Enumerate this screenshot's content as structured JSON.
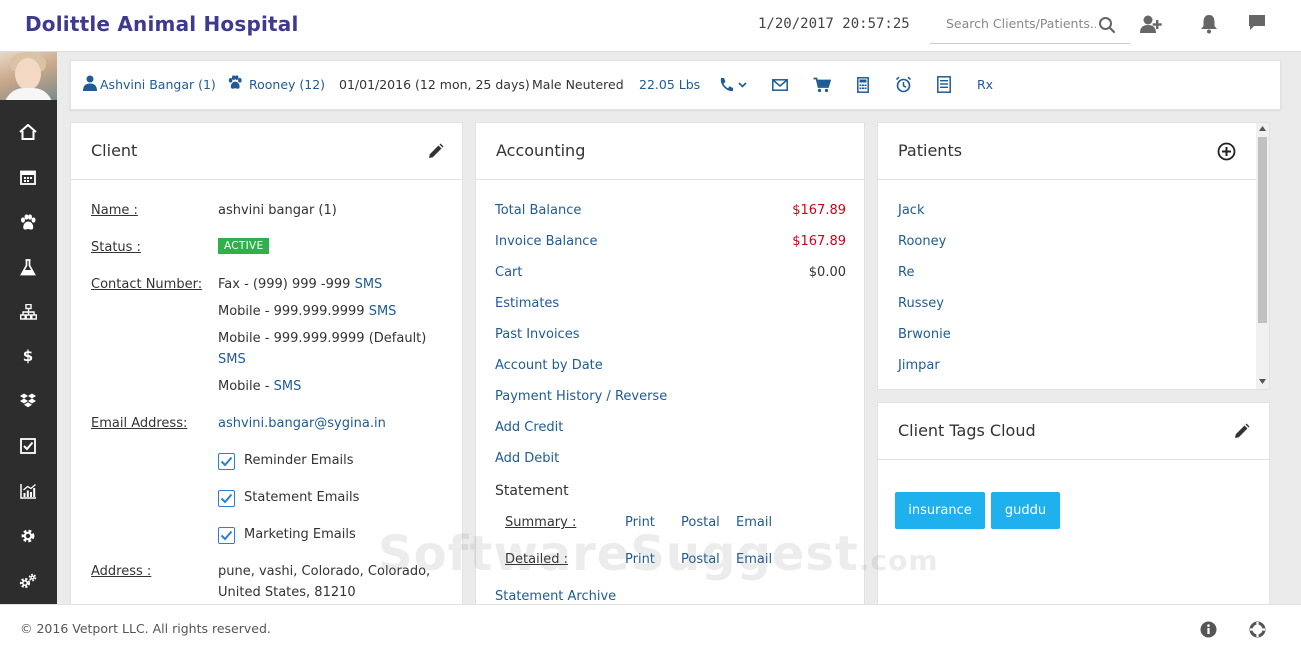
{
  "app": {
    "title": "Dolittle Animal Hospital",
    "datetime": "1/20/2017 20:57:25"
  },
  "search": {
    "placeholder": "Search Clients/Patients..."
  },
  "sidebar": {
    "items": [
      {
        "icon": "home-icon"
      },
      {
        "icon": "calendar-icon"
      },
      {
        "icon": "paw-icon"
      },
      {
        "icon": "flask-icon"
      },
      {
        "icon": "sitemap-icon"
      },
      {
        "icon": "dollar-icon"
      },
      {
        "icon": "dropbox-icon"
      },
      {
        "icon": "checkbox-icon"
      },
      {
        "icon": "chart-icon"
      },
      {
        "icon": "gear-icon"
      },
      {
        "icon": "gears-icon"
      }
    ]
  },
  "infobar": {
    "client": "Ashvini Bangar (1)",
    "patient": "Rooney (12)",
    "dob": "01/01/2016 (12 mon, 25 days)",
    "sex": "Male Neutered",
    "weight": "22.05 Lbs",
    "rx": "Rx"
  },
  "client": {
    "title": "Client",
    "name_label": "Name :",
    "name": "ashvini bangar (1)",
    "status_label": "Status :",
    "status": "ACTIVE",
    "contact_label": "Contact Number:",
    "contacts": [
      {
        "text": "Fax - (999) 999 -999",
        "sms": "SMS"
      },
      {
        "text": "Mobile - 999.999.9999",
        "sms": "SMS"
      },
      {
        "text": "Mobile - 999.999.9999 (Default)",
        "sms": "SMS"
      },
      {
        "text": "Mobile -",
        "sms": "SMS"
      }
    ],
    "email_label": "Email Address:",
    "email": "ashvini.bangar@sygina.in",
    "email_prefs": [
      "Reminder Emails",
      "Statement Emails",
      "Marketing Emails"
    ],
    "address_label": "Address :",
    "address_line1": "pune, vashi, Colorado, Colorado,",
    "address_line2": "United States, 81210"
  },
  "accounting": {
    "title": "Accounting",
    "total_balance_label": "Total Balance",
    "total_balance": "$167.89",
    "invoice_balance_label": "Invoice Balance",
    "invoice_balance": "$167.89",
    "cart_label": "Cart",
    "cart": "$0.00",
    "links": [
      "Estimates",
      "Past Invoices",
      "Account by Date",
      "Payment History / Reverse",
      "Add Credit",
      "Add Debit"
    ],
    "statement_label": "Statement",
    "summary_label": "Summary :",
    "detailed_label": "Detailed :",
    "print": "Print",
    "postal": "Postal",
    "email": "Email",
    "archive": "Statement Archive"
  },
  "patients": {
    "title": "Patients",
    "list": [
      "Jack",
      "Rooney",
      "Re",
      "Russey",
      "Brwonie",
      "Jimpar"
    ]
  },
  "tags": {
    "title": "Client Tags Cloud",
    "list": [
      "insurance",
      "guddu"
    ]
  },
  "footer": {
    "copyright": "© 2016 Vetport LLC. All rights reserved."
  },
  "watermark": {
    "text": "SoftwareSuggest",
    "suffix": ".com"
  },
  "colors": {
    "brand": "#3e3a8f",
    "link": "#1f5b95",
    "balance": "#d0021b",
    "active": "#2fb04a",
    "tag": "#1fb1ee"
  }
}
